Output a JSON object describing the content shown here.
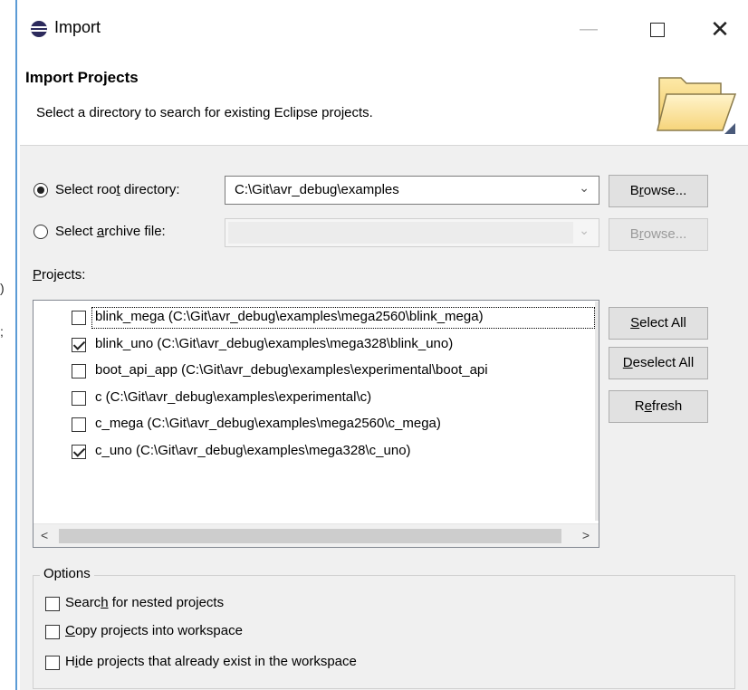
{
  "window": {
    "title": "Import",
    "minimize_glyph": "—",
    "close_glyph": "✕"
  },
  "left_edge": {
    "fragment1": ")",
    "fragment2": ";"
  },
  "header": {
    "title": "Import Projects",
    "description": "Select a directory to search for existing Eclipse projects.",
    "icon": "folder-icon"
  },
  "source": {
    "root_dir": {
      "label_pre": "Select roo",
      "label_ul": "t",
      "label_post": " directory:",
      "selected": true,
      "value": "C:\\Git\\avr_debug\\examples",
      "browse_pre": "B",
      "browse_ul": "r",
      "browse_post": "owse..."
    },
    "archive": {
      "label_pre": "Select ",
      "label_ul": "a",
      "label_post": "rchive file:",
      "selected": false,
      "value": "",
      "browse_pre": "B",
      "browse_ul": "r",
      "browse_post": "owse..."
    }
  },
  "projects": {
    "label_ul": "P",
    "label_post": "rojects:",
    "items": [
      {
        "label": "blink_mega (C:\\Git\\avr_debug\\examples\\mega2560\\blink_mega)",
        "checked": false
      },
      {
        "label": "blink_uno (C:\\Git\\avr_debug\\examples\\mega328\\blink_uno)",
        "checked": true
      },
      {
        "label": "boot_api_app (C:\\Git\\avr_debug\\examples\\experimental\\boot_api",
        "checked": false
      },
      {
        "label": "c (C:\\Git\\avr_debug\\examples\\experimental\\c)",
        "checked": false
      },
      {
        "label": "c_mega (C:\\Git\\avr_debug\\examples\\mega2560\\c_mega)",
        "checked": false
      },
      {
        "label": "c_uno (C:\\Git\\avr_debug\\examples\\mega328\\c_uno)",
        "checked": true
      }
    ],
    "scroll_left": "<",
    "scroll_right": ">"
  },
  "buttons": {
    "select_all": {
      "ul": "S",
      "post": "elect All"
    },
    "deselect_all": {
      "ul": "D",
      "post": "eselect All"
    },
    "refresh": {
      "pre": "R",
      "ul": "e",
      "post": "fresh"
    }
  },
  "options": {
    "legend": "Options",
    "items": [
      {
        "pre": "Searc",
        "ul": "h",
        "post": " for nested projects",
        "checked": false
      },
      {
        "pre": "",
        "ul": "C",
        "post": "opy projects into workspace",
        "checked": false
      },
      {
        "pre": "H",
        "ul": "i",
        "post": "de projects that already exist in the workspace",
        "checked": false
      }
    ]
  }
}
